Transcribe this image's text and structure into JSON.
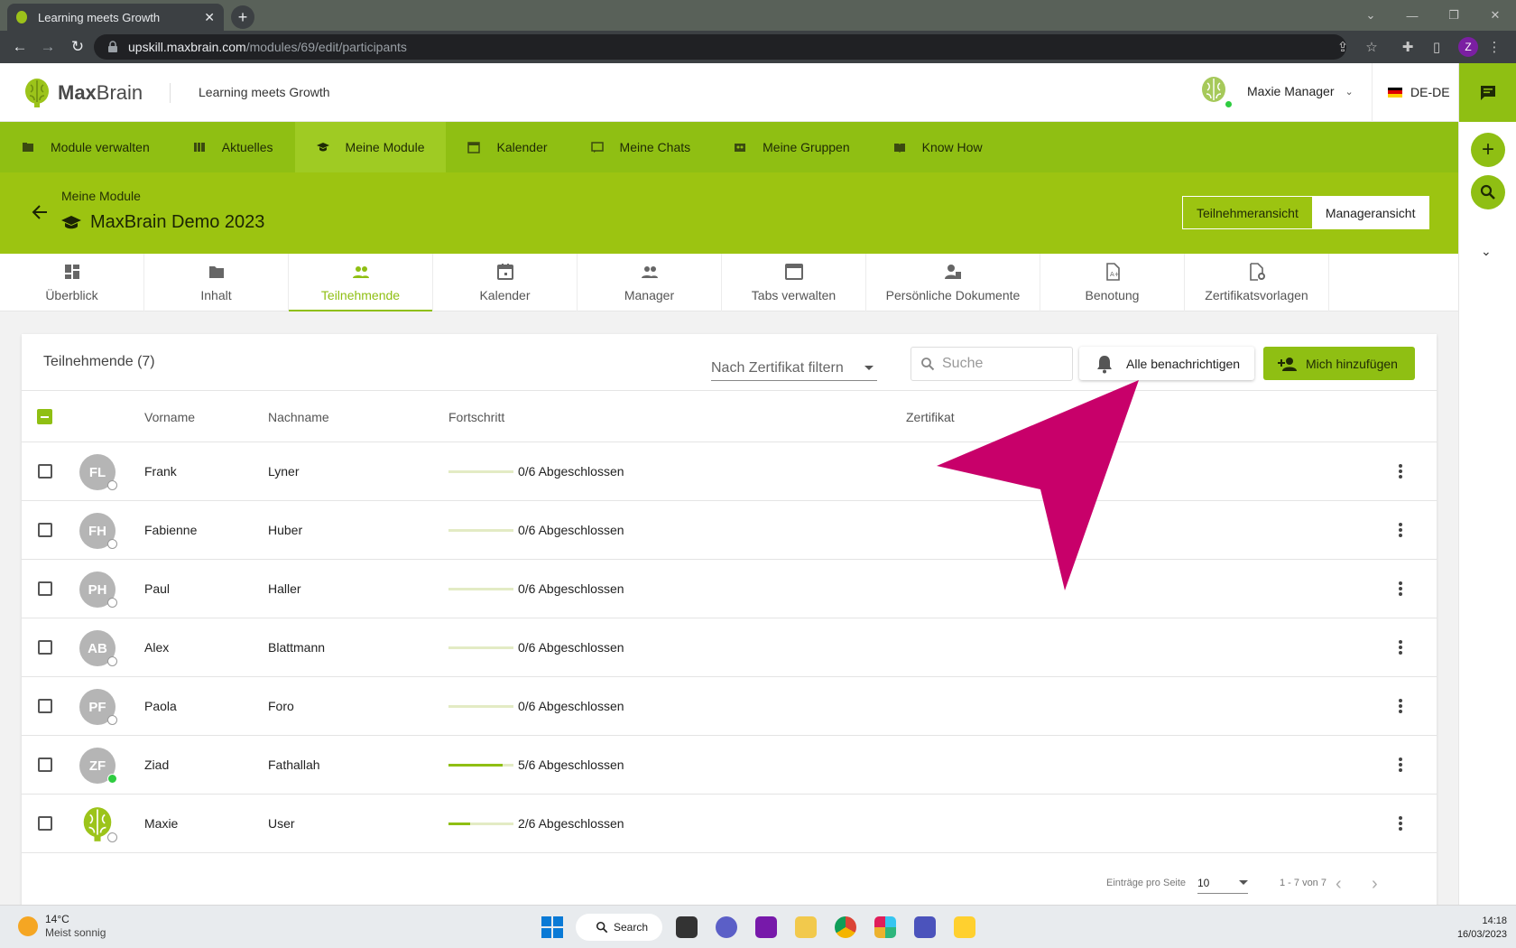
{
  "browser": {
    "tab_title": "Learning meets Growth",
    "url_host": "upskill.maxbrain.com",
    "url_path": "/modules/69/edit/participants",
    "profile_initial": "Z"
  },
  "app": {
    "logo_bold": "Max",
    "logo_light": "Brain",
    "tagline": "Learning meets Growth",
    "user_name": "Maxie Manager",
    "language": "DE-DE"
  },
  "main_nav": [
    {
      "label": "Module verwalten",
      "icon": "folder-icon"
    },
    {
      "label": "Aktuelles",
      "icon": "news-icon"
    },
    {
      "label": "Meine Module",
      "icon": "graduation-cap-icon",
      "active": true
    },
    {
      "label": "Kalender",
      "icon": "calendar-icon"
    },
    {
      "label": "Meine Chats",
      "icon": "chat-icon"
    },
    {
      "label": "Meine Gruppen",
      "icon": "group-icon"
    },
    {
      "label": "Know How",
      "icon": "book-icon"
    }
  ],
  "module": {
    "breadcrumb": "Meine Module",
    "title": "MaxBrain Demo 2023",
    "view_participant": "Teilnehmeransicht",
    "view_manager": "Manageransicht"
  },
  "sub_tabs": [
    {
      "label": "Überblick",
      "icon": "dashboard-icon"
    },
    {
      "label": "Inhalt",
      "icon": "folder-icon"
    },
    {
      "label": "Teilnehmende",
      "icon": "people-icon",
      "active": true
    },
    {
      "label": "Kalender",
      "icon": "calendar-icon"
    },
    {
      "label": "Manager",
      "icon": "people-icon"
    },
    {
      "label": "Tabs verwalten",
      "icon": "window-icon"
    },
    {
      "label": "Persönliche Dokumente",
      "icon": "person-document-icon"
    },
    {
      "label": "Benotung",
      "icon": "grade-document-icon"
    },
    {
      "label": "Zertifikatsvorlagen",
      "icon": "certificate-settings-icon"
    }
  ],
  "participants": {
    "title": "Teilnehmende (7)",
    "cert_filter_placeholder": "Nach Zertifikat filtern",
    "search_placeholder": "Suche",
    "notify_all_label": "Alle benachrichtigen",
    "add_me_label": "Mich hinzufügen",
    "columns": {
      "first": "Vorname",
      "last": "Nachname",
      "progress": "Fortschritt",
      "certificate": "Zertifikat"
    },
    "rows": [
      {
        "initials": "FL",
        "first": "Frank",
        "last": "Lyner",
        "progress_text": "0/6 Abgeschlossen",
        "progress": 0,
        "online": false
      },
      {
        "initials": "FH",
        "first": "Fabienne",
        "last": "Huber",
        "progress_text": "0/6 Abgeschlossen",
        "progress": 0,
        "online": false
      },
      {
        "initials": "PH",
        "first": "Paul",
        "last": "Haller",
        "progress_text": "0/6 Abgeschlossen",
        "progress": 0,
        "online": false
      },
      {
        "initials": "AB",
        "first": "Alex",
        "last": "Blattmann",
        "progress_text": "0/6 Abgeschlossen",
        "progress": 0,
        "online": false
      },
      {
        "initials": "PF",
        "first": "Paola",
        "last": "Foro",
        "progress_text": "0/6 Abgeschlossen",
        "progress": 0,
        "online": false
      },
      {
        "initials": "ZF",
        "first": "Ziad",
        "last": "Fathallah",
        "progress_text": "5/6 Abgeschlossen",
        "progress": 0.833,
        "online": true
      },
      {
        "initials": "",
        "first": "Maxie",
        "last": "User",
        "progress_text": "2/6 Abgeschlossen",
        "progress": 0.333,
        "online": false,
        "brain_avatar": true
      }
    ],
    "pager": {
      "per_page_label": "Einträge pro Seite",
      "per_page": "10",
      "range": "1 - 7 von 7"
    }
  },
  "colors": {
    "brand_green": "#8fbf13",
    "header_green": "#9cc411",
    "pointer_magenta": "#c8006a"
  },
  "taskbar": {
    "temperature": "14°C",
    "weather": "Meist sonnig",
    "search_label": "Search",
    "time": "14:18",
    "date": "16/03/2023"
  }
}
